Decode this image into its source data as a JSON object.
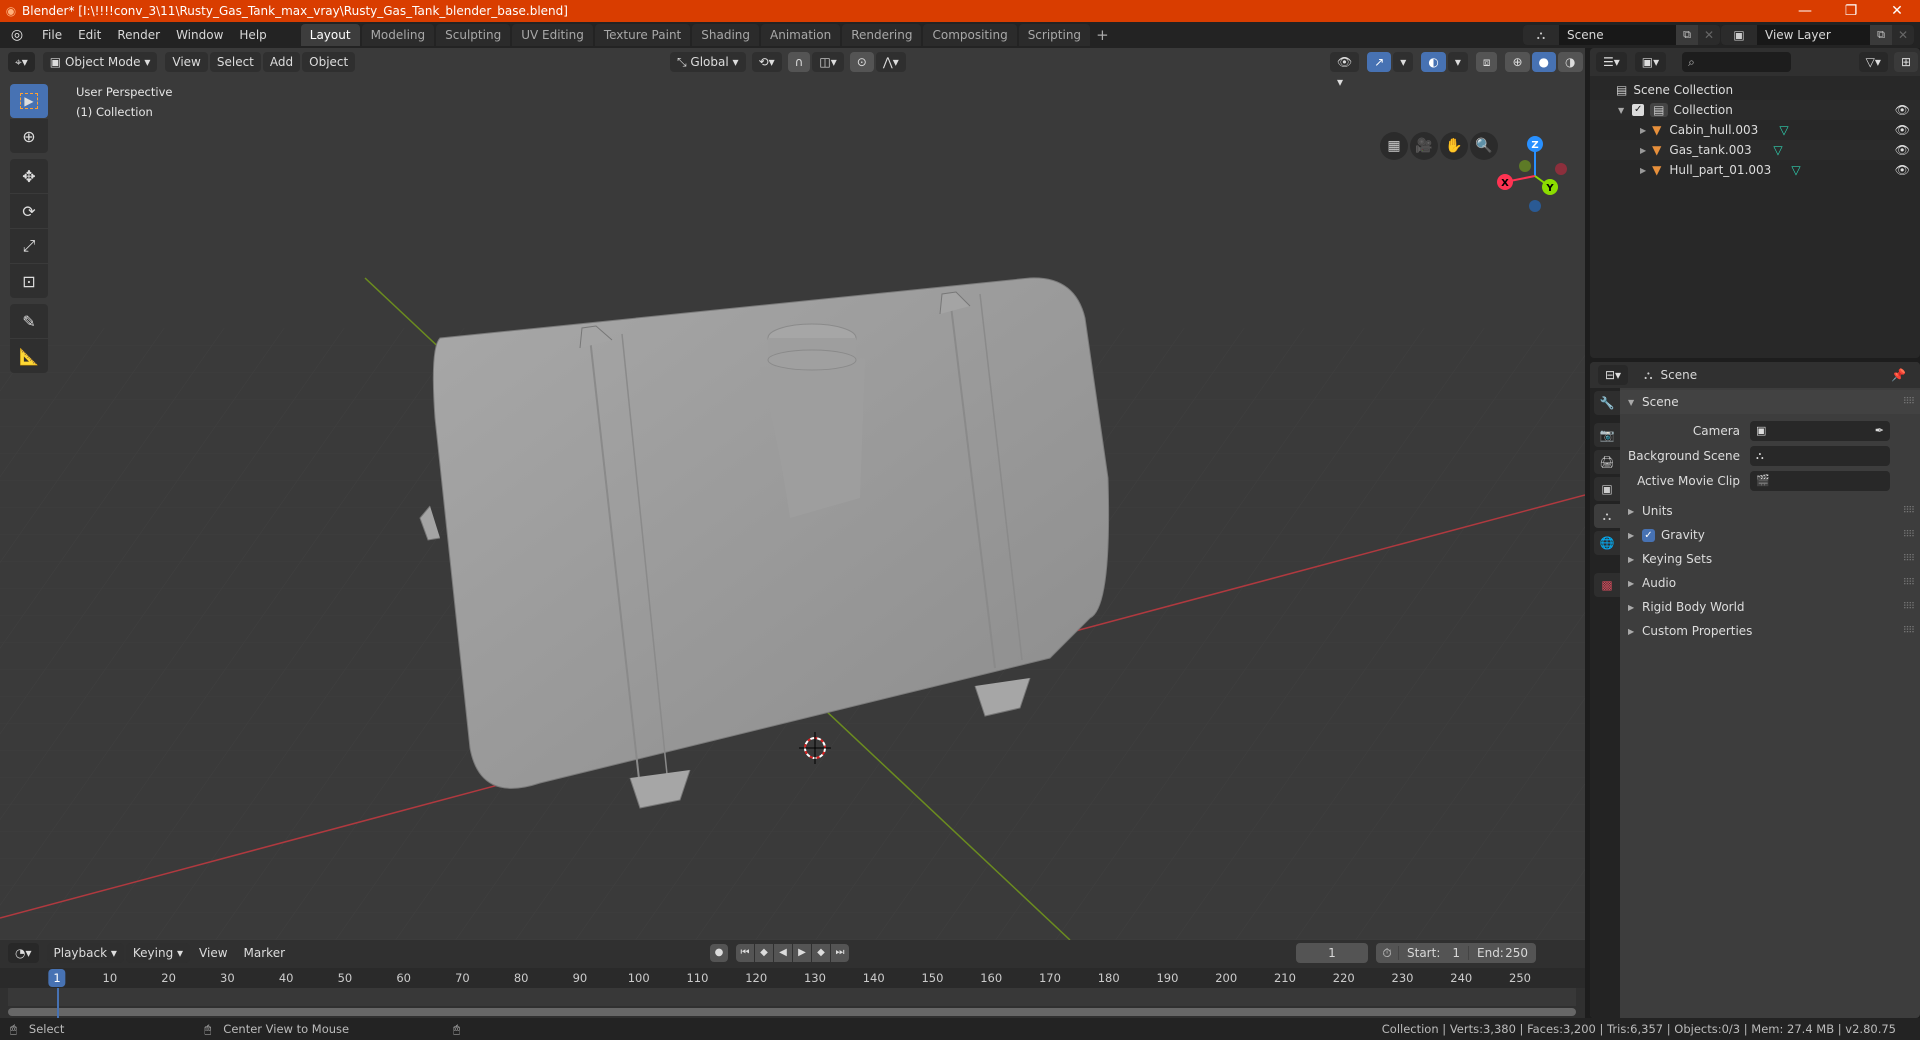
{
  "window": {
    "title": "Blender* [I:\\!!!!conv_3\\11\\Rusty_Gas_Tank_max_vray\\Rusty_Gas_Tank_blender_base.blend]",
    "minimize_icon": "minimize-icon",
    "maximize_icon": "restore-icon",
    "close_icon": "close-icon"
  },
  "menu": [
    "File",
    "Edit",
    "Render",
    "Window",
    "Help"
  ],
  "workspaces": {
    "active": "Layout",
    "tabs": [
      "Layout",
      "Modeling",
      "Sculpting",
      "UV Editing",
      "Texture Paint",
      "Shading",
      "Animation",
      "Rendering",
      "Compositing",
      "Scripting"
    ],
    "add_label": "+"
  },
  "scene_selector": {
    "value": "Scene"
  },
  "view_layer_selector": {
    "value": "View Layer"
  },
  "viewport": {
    "header": {
      "mode": "Object Mode",
      "menus": [
        "View",
        "Select",
        "Add",
        "Object"
      ],
      "orientation": "Global"
    },
    "info_line1": "User Perspective",
    "info_line2": "(1) Collection",
    "gizmo": {
      "x": "X",
      "y": "Y",
      "z": "Z"
    },
    "tools": [
      "select-box",
      "cursor",
      "move",
      "rotate",
      "scale",
      "transform",
      "annotate",
      "measure"
    ],
    "colors": {
      "x_axis": "#ff3352",
      "y_axis": "#8bdc00",
      "z_axis": "#2890ff",
      "accent": "#4772b3"
    }
  },
  "outliner": {
    "search_placeholder": "",
    "root": "Scene Collection",
    "collection": "Collection",
    "objects": [
      {
        "name": "Cabin_hull.003"
      },
      {
        "name": "Gas_tank.003"
      },
      {
        "name": "Hull_part_01.003"
      }
    ]
  },
  "properties": {
    "context": "Scene",
    "panel_title": "Scene",
    "fields": [
      {
        "label": "Camera",
        "value": ""
      },
      {
        "label": "Background Scene",
        "value": ""
      },
      {
        "label": "Active Movie Clip",
        "value": ""
      }
    ],
    "subpanels": [
      {
        "label": "Units"
      },
      {
        "label": "Gravity",
        "checked": true
      },
      {
        "label": "Keying Sets"
      },
      {
        "label": "Audio"
      },
      {
        "label": "Rigid Body World"
      },
      {
        "label": "Custom Properties"
      }
    ]
  },
  "timeline": {
    "menus": [
      "Playback",
      "Keying",
      "View",
      "Marker"
    ],
    "current_frame": "1",
    "start_label": "Start:",
    "start": "1",
    "end_label": "End:",
    "end": "250",
    "ticks": [
      "1",
      "10",
      "20",
      "30",
      "40",
      "50",
      "60",
      "70",
      "80",
      "90",
      "100",
      "110",
      "120",
      "130",
      "140",
      "150",
      "160",
      "170",
      "180",
      "190",
      "200",
      "210",
      "220",
      "230",
      "240",
      "250"
    ]
  },
  "statusbar": {
    "left_hint": "Select",
    "middle_hint": "Center View to Mouse",
    "stats": "Collection | Verts:3,380 | Faces:3,200 | Tris:6,357 | Objects:0/3 | Mem: 27.4 MB | v2.80.75"
  }
}
